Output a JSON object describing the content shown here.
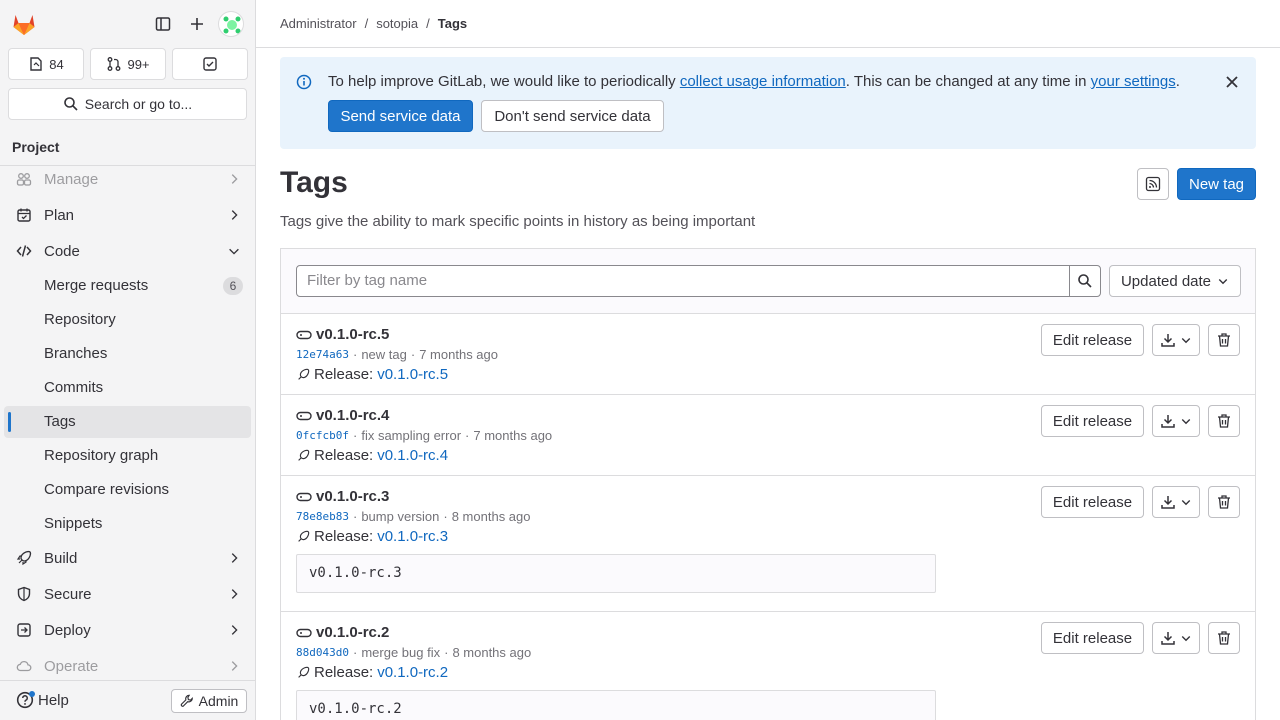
{
  "sidebar": {
    "counts": {
      "issues": "84",
      "merge_requests": "99+"
    },
    "search_label": "Search or go to...",
    "project_heading": "Project",
    "nav": [
      {
        "label": "Manage",
        "icon": "users-icon"
      },
      {
        "label": "Plan",
        "icon": "planning-icon"
      },
      {
        "label": "Code",
        "icon": "code-icon"
      }
    ],
    "code_sub": [
      {
        "label": "Merge requests",
        "badge": "6"
      },
      {
        "label": "Repository"
      },
      {
        "label": "Branches"
      },
      {
        "label": "Commits"
      },
      {
        "label": "Tags"
      },
      {
        "label": "Repository graph"
      },
      {
        "label": "Compare revisions"
      },
      {
        "label": "Snippets"
      }
    ],
    "nav_after": [
      {
        "label": "Build",
        "icon": "rocket-icon"
      },
      {
        "label": "Secure",
        "icon": "shield-icon"
      },
      {
        "label": "Deploy",
        "icon": "deploy-icon"
      },
      {
        "label": "Operate",
        "icon": "cloud-icon"
      }
    ],
    "help_label": "Help",
    "admin_label": "Admin"
  },
  "breadcrumb": [
    "Administrator",
    "sotopia",
    "Tags"
  ],
  "banner": {
    "text_before": "To help improve GitLab, we would like to periodically ",
    "link1": "collect usage information",
    "text_middle": ". This can be changed at any time in ",
    "link2": "your settings",
    "text_after": ".",
    "send_label": "Send service data",
    "dont_send_label": "Don't send service data"
  },
  "page": {
    "title": "Tags",
    "description": "Tags give the ability to mark specific points in history as being important",
    "new_tag_label": "New tag",
    "filter_placeholder": "Filter by tag name",
    "sort_label": "Updated date"
  },
  "tags": [
    {
      "name": "v0.1.0-rc.5",
      "sha": "12e74a63",
      "commit": "new tag",
      "time": "7 months ago",
      "release_label": "Release:",
      "release": "v0.1.0-rc.5",
      "message": "",
      "edit_label": "Edit release"
    },
    {
      "name": "v0.1.0-rc.4",
      "sha": "0fcfcb0f",
      "commit": "fix sampling error",
      "time": "7 months ago",
      "release_label": "Release:",
      "release": "v0.1.0-rc.4",
      "message": "",
      "edit_label": "Edit release"
    },
    {
      "name": "v0.1.0-rc.3",
      "sha": "78e8eb83",
      "commit": "bump version",
      "time": "8 months ago",
      "release_label": "Release:",
      "release": "v0.1.0-rc.3",
      "message": "v0.1.0-rc.3",
      "edit_label": "Edit release"
    },
    {
      "name": "v0.1.0-rc.2",
      "sha": "88d043d0",
      "commit": "merge bug fix",
      "time": "8 months ago",
      "release_label": "Release:",
      "release": "v0.1.0-rc.2",
      "message": "v0.1.0-rc.2",
      "edit_label": "Edit release"
    }
  ],
  "colors": {
    "accent": "#1f75cb",
    "link": "#1068bf",
    "banner_bg": "#e9f3fc",
    "sidebar_bg": "#f4f4f5"
  }
}
